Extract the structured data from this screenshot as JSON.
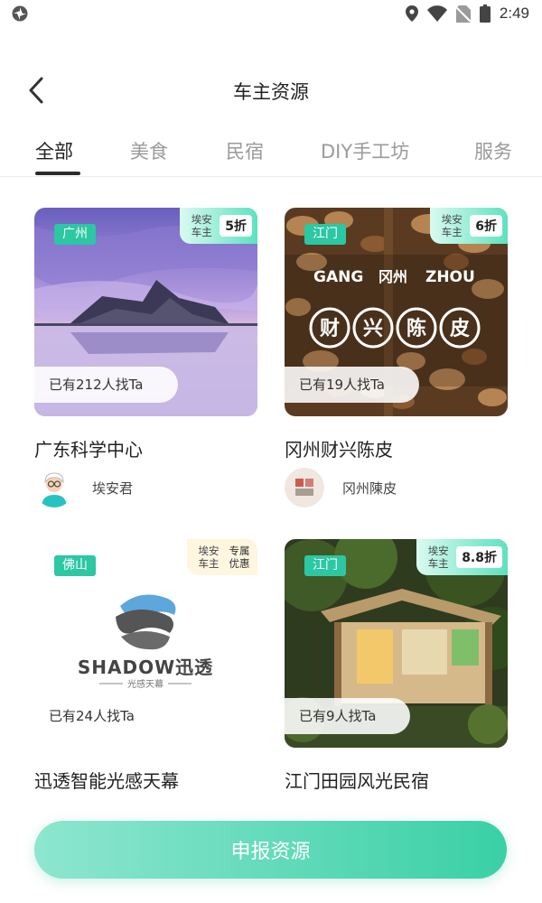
{
  "status_bar": {
    "time": "2:49",
    "icons": [
      "aperture-icon",
      "location-icon",
      "wifi-icon",
      "no-sim-icon",
      "battery-icon"
    ]
  },
  "header": {
    "title": "车主资源",
    "back_icon": "chevron-left-icon"
  },
  "tabs": [
    {
      "label": "全部",
      "active": true
    },
    {
      "label": "美食",
      "active": false
    },
    {
      "label": "民宿",
      "active": false
    },
    {
      "label": "DIY手工坊",
      "active": false
    },
    {
      "label": "服务",
      "active": false
    }
  ],
  "cards": [
    {
      "city": "广州",
      "owner_tag": "埃安车主",
      "discount": "5折",
      "seekers": "已有212人找Ta",
      "name": "广东科学中心",
      "owner_name": "埃安君"
    },
    {
      "city": "江门",
      "owner_tag": "埃安车主",
      "discount": "6折",
      "seekers": "已有19人找Ta",
      "name": "冈州财兴陈皮",
      "owner_name": "冈州陳皮",
      "image_text": {
        "line1_left": "GANG",
        "line1_mid": "冈州",
        "line1_right": "ZHOU",
        "circles": [
          "财",
          "兴",
          "陈",
          "皮"
        ]
      }
    },
    {
      "city": "佛山",
      "owner_tag": "埃安车主",
      "discount": "专属优惠",
      "seekers": "已有24人找Ta",
      "name": "迅透智能光感天幕",
      "logo": {
        "brand": "SHADOW迅透",
        "tagline": "光感天幕"
      }
    },
    {
      "city": "江门",
      "owner_tag": "埃安车主",
      "discount": "8.8折",
      "seekers": "已有9人找Ta",
      "name": "江门田园风光民宿"
    }
  ],
  "submit_button": {
    "label": "申报资源"
  },
  "colors": {
    "accent": "#2cc7a3",
    "button_start": "#8ee6cf",
    "button_end": "#3ad0a6"
  }
}
